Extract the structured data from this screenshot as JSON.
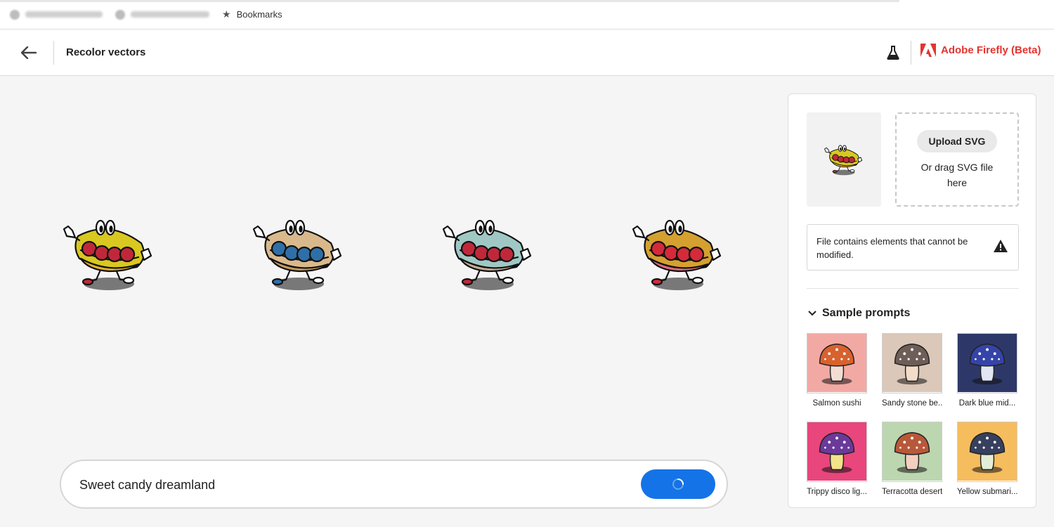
{
  "bookmarks_bar": {
    "bookmarks_label": "Bookmarks"
  },
  "header": {
    "title": "Recolor vectors",
    "brand": "Adobe Firefly (Beta)",
    "brand_color": "#e3342f"
  },
  "variants": [
    {
      "bun": "#d8c820",
      "filling": "#c0283a",
      "shade": "#e0b030"
    },
    {
      "bun": "#d9b98c",
      "filling": "#2f6fa8",
      "shade": "#c89a5a"
    },
    {
      "bun": "#9fc8c4",
      "filling": "#c0283a",
      "shade": "#c8ad94"
    },
    {
      "bun": "#d4a030",
      "filling": "#d42a3a",
      "shade": "#e06a7a"
    }
  ],
  "prompt": {
    "value": "Sweet candy dreamland",
    "button_color": "#1473e6"
  },
  "panel": {
    "upload_button": "Upload SVG",
    "upload_hint": "Or drag SVG file here",
    "warning": "File contains elements that cannot be modified.",
    "section_title": "Sample prompts",
    "samples": [
      {
        "label": "Salmon sushi",
        "bg": "#f2a9a4",
        "cap": "#d7622e",
        "stem": "#f3ddd2"
      },
      {
        "label": "Sandy stone be...",
        "bg": "#dbc8b8",
        "cap": "#6e5e58",
        "stem": "#f3dcc8"
      },
      {
        "label": "Dark blue mid...",
        "bg": "#2e3868",
        "cap": "#3544a8",
        "stem": "#e0e6f2"
      },
      {
        "label": "Trippy disco lig...",
        "bg": "#e8467c",
        "cap": "#6a3a9a",
        "stem": "#f2e28a"
      },
      {
        "label": "Terracotta desert",
        "bg": "#bcd6b0",
        "cap": "#b8583a",
        "stem": "#f2cfc0"
      },
      {
        "label": "Yellow submari...",
        "bg": "#f6bd5e",
        "cap": "#37405e",
        "stem": "#e2eed8"
      }
    ]
  }
}
